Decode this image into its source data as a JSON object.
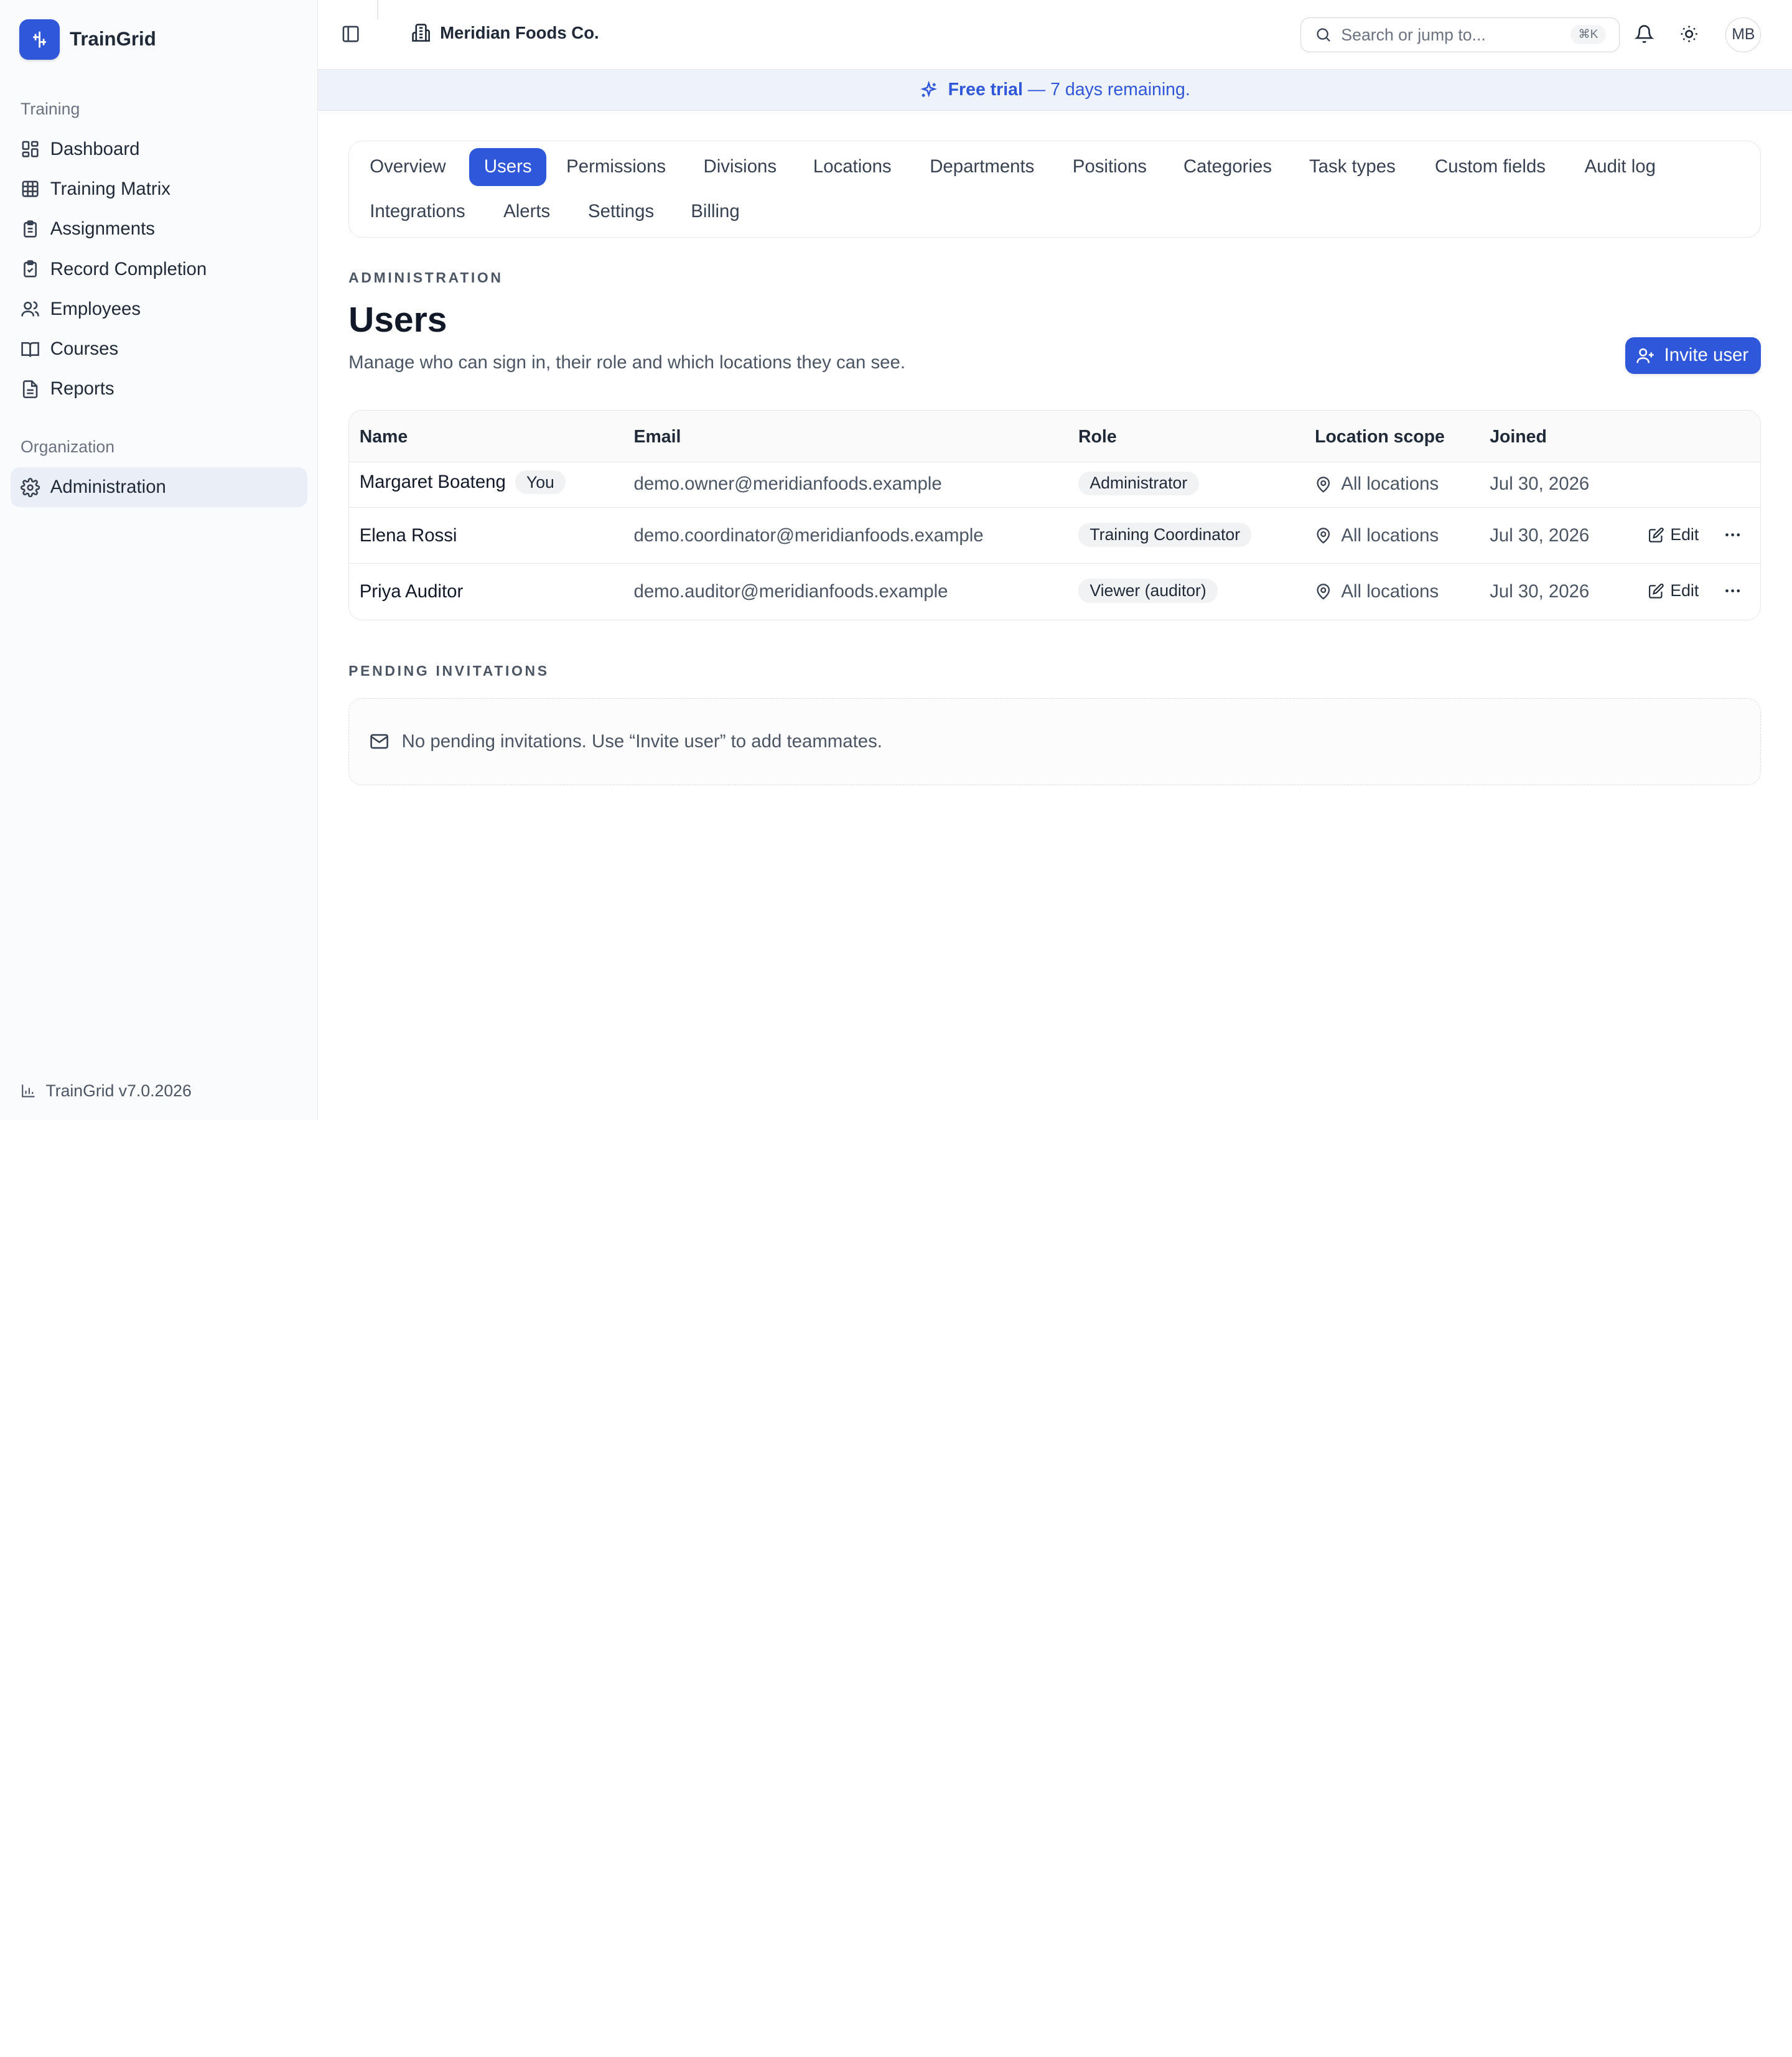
{
  "app": {
    "name": "TrainGrid",
    "version": "TrainGrid v7.0.2026"
  },
  "sidebar": {
    "sections": [
      {
        "label": "Training"
      },
      {
        "label": "Organization"
      }
    ],
    "items": [
      {
        "label": "Dashboard",
        "icon": "dashboard-icon"
      },
      {
        "label": "Training Matrix",
        "icon": "grid-icon"
      },
      {
        "label": "Assignments",
        "icon": "clipboard-icon"
      },
      {
        "label": "Record Completion",
        "icon": "clipboard-check-icon"
      },
      {
        "label": "Employees",
        "icon": "users-icon"
      },
      {
        "label": "Courses",
        "icon": "book-icon"
      },
      {
        "label": "Reports",
        "icon": "file-icon"
      },
      {
        "label": "Administration",
        "icon": "gear-icon",
        "active": true
      }
    ]
  },
  "topbar": {
    "org_name": "Meridian Foods Co.",
    "search_placeholder": "Search or jump to...",
    "search_shortcut": "⌘K",
    "avatar_initials": "MB"
  },
  "banner": {
    "strong": "Free trial",
    "rest": " — 7 days remaining."
  },
  "tabs": [
    {
      "label": "Overview"
    },
    {
      "label": "Users",
      "active": true
    },
    {
      "label": "Permissions"
    },
    {
      "label": "Divisions"
    },
    {
      "label": "Locations"
    },
    {
      "label": "Departments"
    },
    {
      "label": "Positions"
    },
    {
      "label": "Categories"
    },
    {
      "label": "Task types"
    },
    {
      "label": "Custom fields"
    },
    {
      "label": "Audit log"
    },
    {
      "label": "Integrations"
    },
    {
      "label": "Alerts"
    },
    {
      "label": "Settings"
    },
    {
      "label": "Billing"
    }
  ],
  "page": {
    "eyebrow": "ADMINISTRATION",
    "title": "Users",
    "description": "Manage who can sign in, their role and which locations they can see.",
    "invite_button": "Invite user"
  },
  "table": {
    "columns": [
      "Name",
      "Email",
      "Role",
      "Location scope",
      "Joined"
    ],
    "rows": [
      {
        "name": "Margaret Boateng",
        "badge": "You",
        "email": "demo.owner@meridianfoods.example",
        "role": "Administrator",
        "scope": "All locations",
        "joined": "Jul 30, 2026",
        "edit": ""
      },
      {
        "name": "Elena Rossi",
        "badge": "",
        "email": "demo.coordinator@meridianfoods.example",
        "role": "Training Coordinator",
        "scope": "All locations",
        "joined": "Jul 30, 2026",
        "edit": "Edit"
      },
      {
        "name": "Priya Auditor",
        "badge": "",
        "email": "demo.auditor@meridianfoods.example",
        "role": "Viewer (auditor)",
        "scope": "All locations",
        "joined": "Jul 30, 2026",
        "edit": "Edit"
      }
    ]
  },
  "pending": {
    "label": "PENDING INVITATIONS",
    "empty_message": "No pending invitations. Use “Invite user” to add teammates."
  },
  "colors": {
    "accent": "#2f57d9",
    "sidebar_active": "#eaeef6",
    "banner_bg": "#eef2fb"
  }
}
